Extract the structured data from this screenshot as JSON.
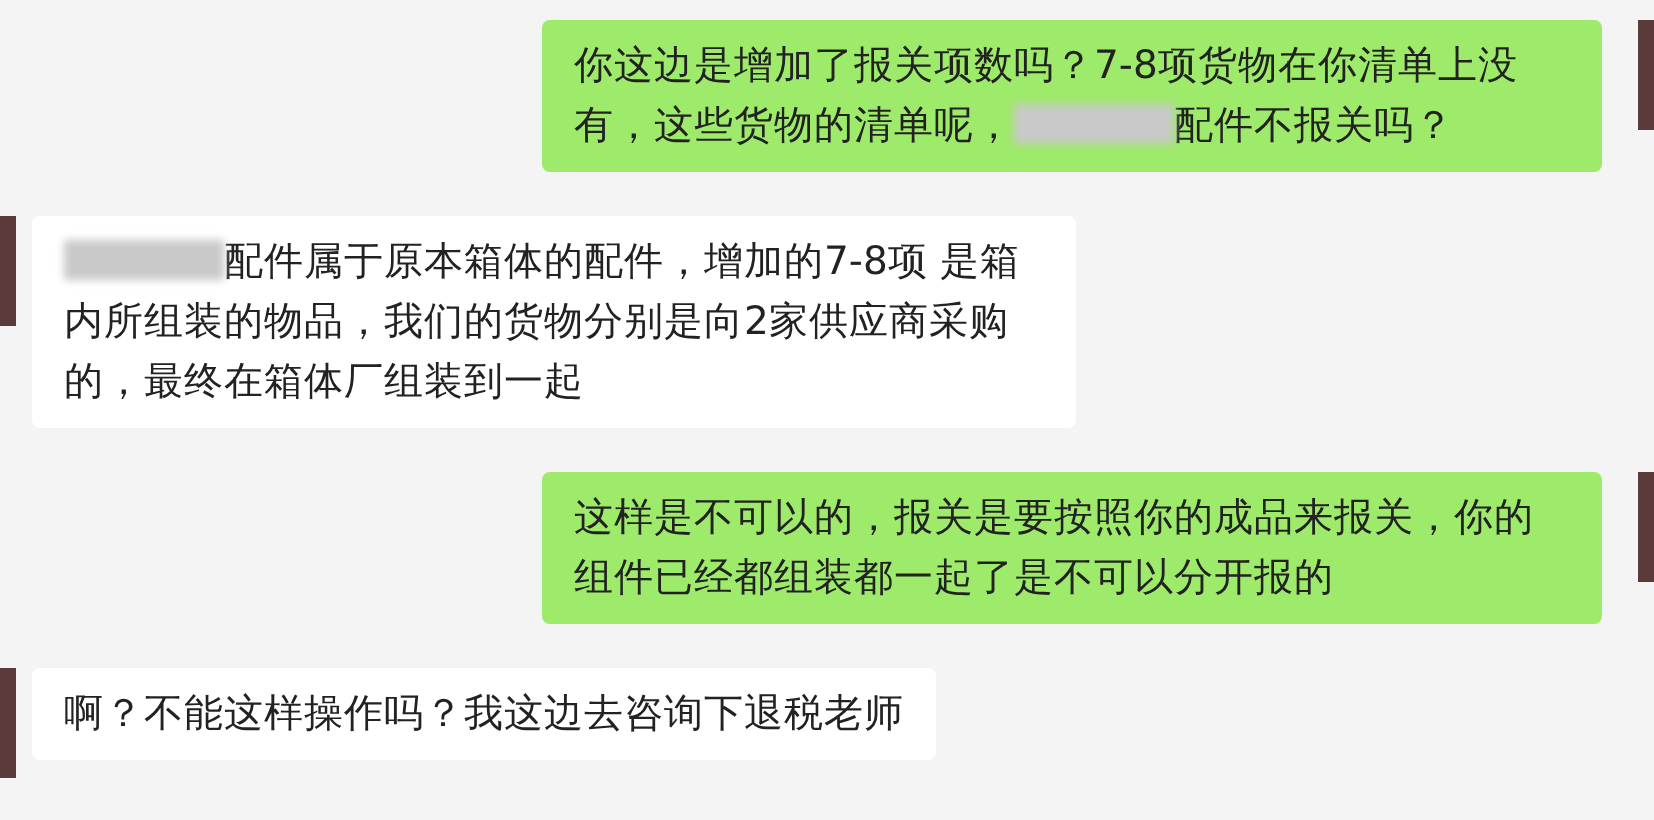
{
  "messages": [
    {
      "kind": "sent",
      "parts": [
        {
          "kind": "text",
          "text": "你这边是增加了报关项数吗？7-8项货物在你清单上没有，这些货物的清单呢，"
        },
        {
          "kind": "redacted"
        },
        {
          "kind": "text",
          "text": "配件不报关吗？"
        }
      ]
    },
    {
      "kind": "received",
      "parts": [
        {
          "kind": "redacted"
        },
        {
          "kind": "text",
          "text": "配件属于原本箱体的配件，增加的7-8项 是箱内所组装的物品，我们的货物分别是向2家供应商采购的，最终在箱体厂组装到一起"
        }
      ]
    },
    {
      "kind": "sent",
      "parts": [
        {
          "kind": "text",
          "text": "这样是不可以的，报关是要按照你的成品来报关，你的组件已经都组装都一起了是不可以分开报的"
        }
      ]
    },
    {
      "kind": "received",
      "parts": [
        {
          "kind": "text",
          "text": "啊？不能这样操作吗？我这边去咨询下退税老师"
        }
      ]
    }
  ]
}
